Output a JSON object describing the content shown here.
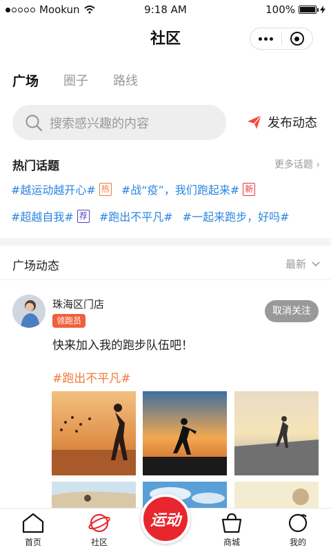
{
  "status_bar": {
    "carrier": "Mookun",
    "time": "9:18 AM",
    "battery": "100%"
  },
  "nav": {
    "title": "社区"
  },
  "tabs": [
    {
      "label": "广场",
      "active": true
    },
    {
      "label": "圈子",
      "active": false
    },
    {
      "label": "路线",
      "active": false
    }
  ],
  "search": {
    "placeholder": "搜索感兴趣的内容"
  },
  "publish": {
    "label": "发布动态"
  },
  "hot_topics": {
    "title": "热门话题",
    "more": "更多话题",
    "items": [
      {
        "text": "#越运动越开心#",
        "tag": "热"
      },
      {
        "text": "#战“疫”，我们跑起来#",
        "tag": "新"
      },
      {
        "text": "#超越自我#",
        "tag": "荐"
      },
      {
        "text": "#跑出不平凡#",
        "tag": ""
      },
      {
        "text": "#一起来跑步，好吗#",
        "tag": ""
      }
    ]
  },
  "feed": {
    "title": "广场动态",
    "sort": "最新"
  },
  "post": {
    "author": "珠海区门店",
    "role": "领跑员",
    "unfollow": "取消关注",
    "text": "快来加入我的跑步队伍吧！",
    "topic": "#跑出不平凡#"
  },
  "tabbar": {
    "items": [
      {
        "label": "首页"
      },
      {
        "label": "社区"
      },
      {
        "label": "运动"
      },
      {
        "label": "商城"
      },
      {
        "label": "我的"
      }
    ]
  },
  "colors": {
    "accent_red": "#e8262d",
    "topic_blue": "#2a86e0",
    "topic_orange": "#f0783c"
  }
}
